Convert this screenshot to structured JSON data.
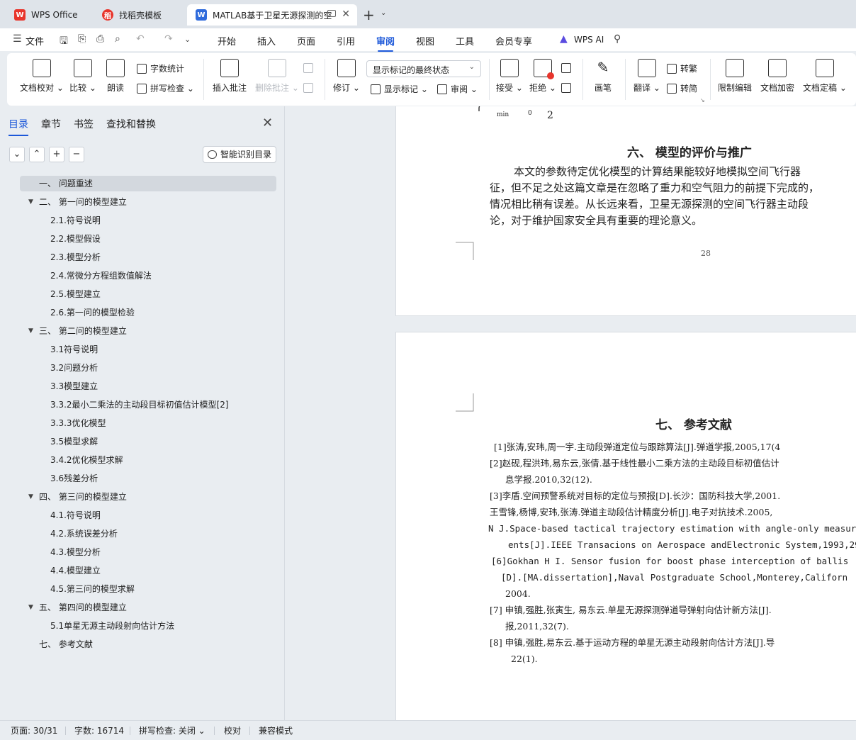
{
  "tabs": [
    {
      "label": "WPS Office",
      "icon": "wps-logo-icon"
    },
    {
      "label": "找稻壳模板",
      "icon": "docer-icon"
    },
    {
      "label": "MATLAB基于卫星无源探测的空",
      "icon": "writer-icon"
    }
  ],
  "menu": {
    "file": "文件",
    "items": [
      "开始",
      "插入",
      "页面",
      "引用",
      "审阅",
      "视图",
      "工具",
      "会员专享"
    ],
    "active": "审阅",
    "wps_ai": "WPS AI"
  },
  "ribbon": {
    "doc_proofread": "文档校对",
    "compare": "比较",
    "read_aloud": "朗读",
    "word_count": "字数统计",
    "spell_check": "拼写检查",
    "insert_comment": "插入批注",
    "delete_comment": "删除批注",
    "track_changes": "修订",
    "markup_state": "显示标记的最终状态",
    "show_markup": "显示标记",
    "review_pane": "审阅",
    "accept": "接受",
    "reject": "拒绝",
    "ink": "画笔",
    "translate": "翻译",
    "to_traditional": "转繁",
    "to_simplified": "转简",
    "restrict_edit": "限制编辑",
    "encrypt": "文档加密",
    "finalize": "文档定稿"
  },
  "nav": {
    "tabs": [
      "目录",
      "章节",
      "书签",
      "查找和替换"
    ],
    "smart_toc": "智能识别目录",
    "toc": [
      {
        "text": "一、 问题重述",
        "level": 1,
        "expanded": null
      },
      {
        "text": "二、 第一问的模型建立",
        "level": 1,
        "expanded": true
      },
      {
        "text": "2.1.符号说明",
        "level": 2
      },
      {
        "text": "2.2.模型假设",
        "level": 2
      },
      {
        "text": "2.3.模型分析",
        "level": 2
      },
      {
        "text": "2.4.常微分方程组数值解法",
        "level": 2
      },
      {
        "text": "2.5.模型建立",
        "level": 2
      },
      {
        "text": "2.6.第一问的模型检验",
        "level": 2
      },
      {
        "text": "三、 第二问的模型建立",
        "level": 1,
        "expanded": true
      },
      {
        "text": "3.1符号说明",
        "level": 2
      },
      {
        "text": "3.2问题分析",
        "level": 2
      },
      {
        "text": "3.3模型建立",
        "level": 2
      },
      {
        "text": "3.3.2最小二乘法的主动段目标初值估计模型[2]",
        "level": 2
      },
      {
        "text": "3.3.3优化模型",
        "level": 2
      },
      {
        "text": "3.5模型求解",
        "level": 2
      },
      {
        "text": "3.4.2优化模型求解",
        "level": 2
      },
      {
        "text": "3.6残差分析",
        "level": 2
      },
      {
        "text": "四、 第三问的模型建立",
        "level": 1,
        "expanded": true
      },
      {
        "text": "4.1.符号说明",
        "level": 2
      },
      {
        "text": "4.2.系统误差分析",
        "level": 2
      },
      {
        "text": "4.3.模型分析",
        "level": 2
      },
      {
        "text": "4.4.模型建立",
        "level": 2
      },
      {
        "text": "4.5.第三问的模型求解",
        "level": 2
      },
      {
        "text": "五、 第四问的模型建立",
        "level": 1,
        "expanded": true
      },
      {
        "text": "5.1单星无源主动段射向估计方法",
        "level": 2
      },
      {
        "text": "七、 参考文献",
        "level": 1,
        "expanded": null
      }
    ]
  },
  "page1": {
    "formula_sub": "min",
    "formula_zero": "0",
    "formula_two": "2",
    "heading": "六、  模型的评价与推广",
    "para": [
      "本文的参数待定优化模型的计算结果能较好地模拟空间飞行器",
      "征，但不足之处这篇文章是在忽略了重力和空气阻力的前提下完成的，",
      "情况相比稍有误差。从长远来看，卫星无源探测的空间飞行器主动段",
      "论，对于维护国家安全具有重要的理论意义。"
    ],
    "page_number": "28"
  },
  "page2": {
    "heading": "七、  参考文献",
    "refs": [
      "[1]张涛,安玮,周一宇.主动段弹道定位与跟踪算法[J].弹道学报,2005,17(4",
      "[2]赵砚,程洪玮,易东云,张倩.基于线性最小二乘方法的主动段目标初值估计",
      "息学报.2010,32(12).",
      "[3]李盾.空间预警系统对目标的定位与预报[D].长沙：国防科技大学,2001.",
      "王雪锋,杨博,安玮,张涛.弹道主动段估计精度分析[J].电子对抗技术.2005,",
      "N J.Space-based tactical trajectory estimation with angle-only measur",
      "ents[J].IEEE Transacions on Aerospace andElectronic System,1993,29",
      "[6]Gokhan H I. Sensor fusion for boost phase interception of ballis",
      "[D].[MA.dissertation],Naval Postgraduate School,Monterey,Californ",
      "2004.",
      "[7] 申镇,强胜,张寅生, 易东云.单星无源探测弹道导弹射向估计新方法[J].",
      "报,2011,32(7).",
      "[8] 申镇,强胜,易东云.基于运动方程的单星无源主动段射向估计方法[J].导",
      "22(1)."
    ]
  },
  "status": {
    "page": "页面: 30/31",
    "words": "字数: 16714",
    "spell": "拼写检查: 关闭",
    "proof": "校对",
    "compat": "兼容模式"
  },
  "colors": {
    "accent": "#1c58d9",
    "wps_red": "#e8352c"
  }
}
